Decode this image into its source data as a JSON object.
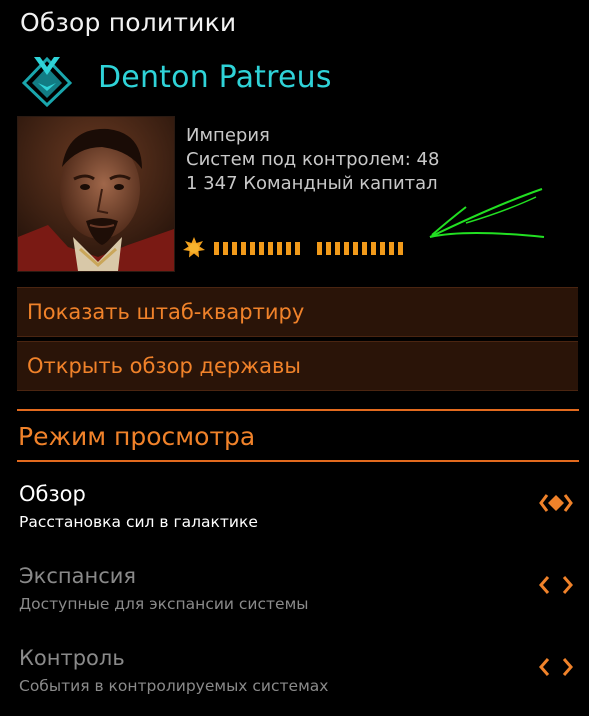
{
  "panel": {
    "title": "Обзор политики"
  },
  "leader": {
    "name": "Denton Patreus",
    "emblem_icon": "empire-emblem-icon",
    "portrait": "leader-portrait",
    "faction": "Империя",
    "systems_controlled": "Систем под контролем: 48",
    "command_capital": "1 347 Командный капитал",
    "progress_icon": "star-icon",
    "progress_pips": 20
  },
  "actions": {
    "show_hq": "Показать штаб-квартиру",
    "open_realm_overview": "Открыть обзор державы"
  },
  "view_mode": {
    "title": "Режим просмотра",
    "items": [
      {
        "title": "Обзор",
        "subtitle": "Расстановка сил в галактике",
        "active": true,
        "icon": "selected-diamond-icon"
      },
      {
        "title": "Экспансия",
        "subtitle": "Доступные для экспансии системы",
        "active": false,
        "icon": "chevron-selector-icon"
      },
      {
        "title": "Контроль",
        "subtitle": "События в контролируемых системах",
        "active": false,
        "icon": "chevron-selector-icon"
      }
    ]
  },
  "colors": {
    "accent_orange": "#f0822a",
    "leader_cyan": "#2fd3d8",
    "pip_orange": "#f19a1a",
    "annotation_green": "#22e022",
    "button_bg": "#2a1408"
  }
}
